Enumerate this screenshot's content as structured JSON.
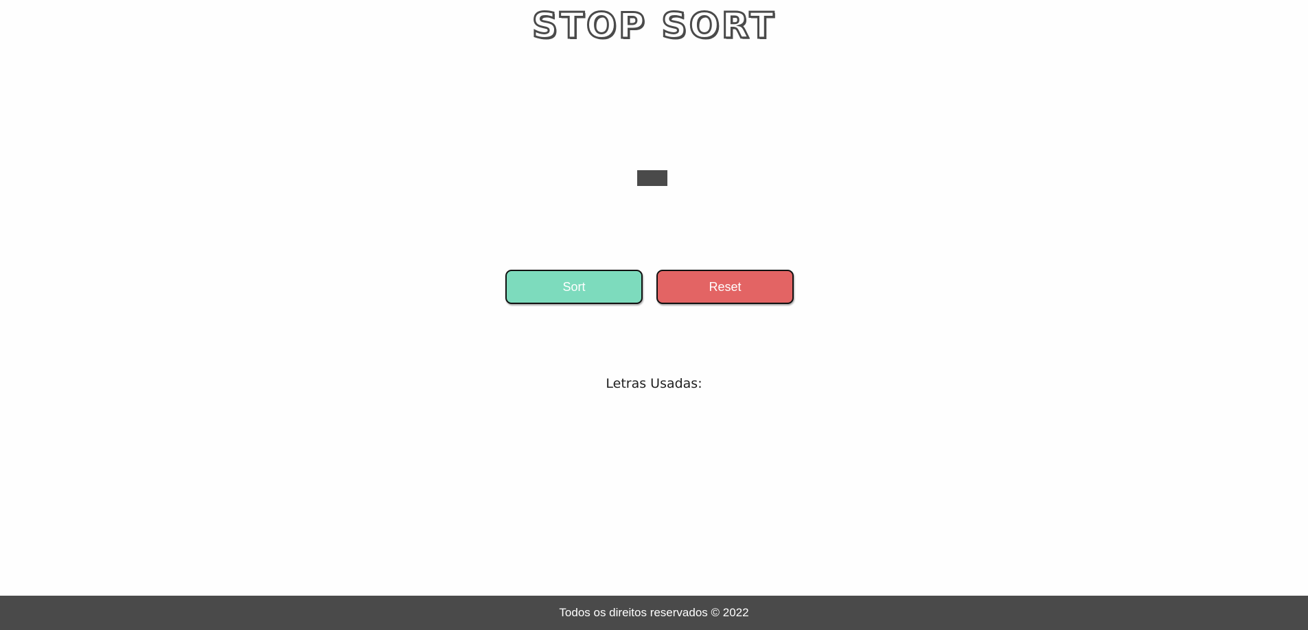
{
  "header": {
    "title": "STOP SORT"
  },
  "letter": {
    "value": ""
  },
  "actions": {
    "sort_label": "Sort",
    "reset_label": "Reset"
  },
  "used_letters": {
    "label": "Letras Usadas:",
    "items": []
  },
  "footer": {
    "text": "Todos os direitos reservados © 2022"
  },
  "colors": {
    "sort_button": "#7ddbbd",
    "reset_button": "#e36464",
    "dark": "#4a4a4a"
  }
}
